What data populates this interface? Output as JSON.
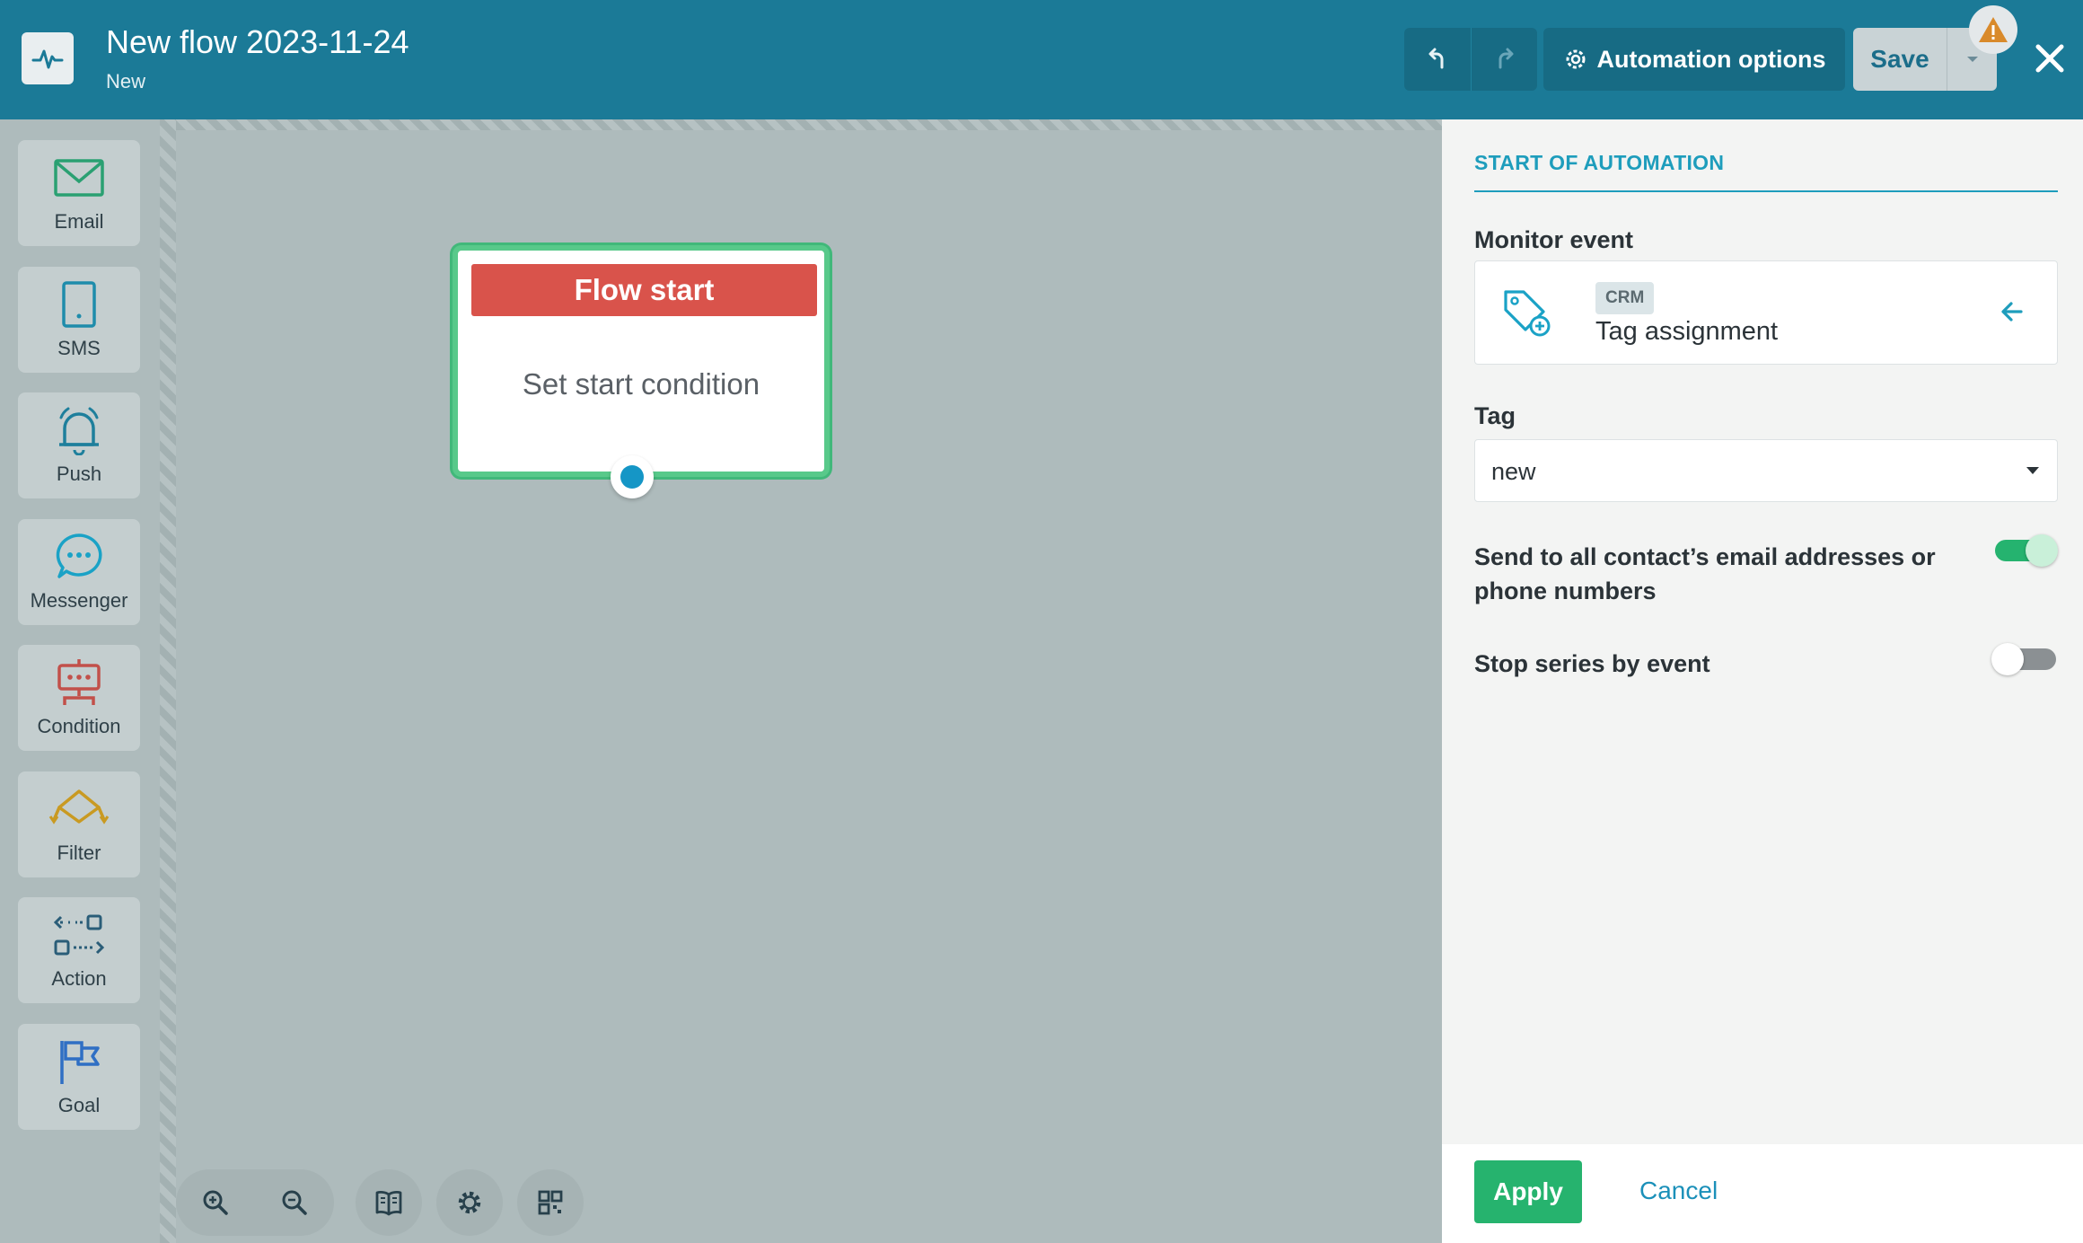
{
  "header": {
    "title": "New flow 2023-11-24",
    "subtitle": "New",
    "automation_options_label": "Automation options",
    "save_label": "Save"
  },
  "toolbox": [
    {
      "label": "Email",
      "icon": "envelope-icon"
    },
    {
      "label": "SMS",
      "icon": "phone-icon"
    },
    {
      "label": "Push",
      "icon": "bell-icon"
    },
    {
      "label": "Messenger",
      "icon": "chat-bubble-icon"
    },
    {
      "label": "Condition",
      "icon": "condition-icon"
    },
    {
      "label": "Filter",
      "icon": "filter-icon"
    },
    {
      "label": "Action",
      "icon": "action-icon"
    },
    {
      "label": "Goal",
      "icon": "flag-icon"
    }
  ],
  "canvas": {
    "node": {
      "header": "Flow start",
      "body": "Set start condition"
    }
  },
  "panel": {
    "title": "START OF AUTOMATION",
    "monitor_event_label": "Monitor event",
    "event": {
      "badge": "CRM",
      "name": "Tag assignment"
    },
    "tag_label": "Tag",
    "tag_value": "new",
    "send_all_label": "Send to all contact’s email addresses or phone numbers",
    "send_all_enabled": true,
    "stop_series_label": "Stop series by event",
    "stop_series_enabled": false,
    "apply_label": "Apply",
    "cancel_label": "Cancel"
  },
  "colors": {
    "header_bg": "#1b7a97",
    "canvas_bg": "#aebbbc",
    "node_border": "#58c98a",
    "node_header": "#d9534b",
    "accent": "#1e9dbc",
    "apply_green": "#26b36e"
  }
}
